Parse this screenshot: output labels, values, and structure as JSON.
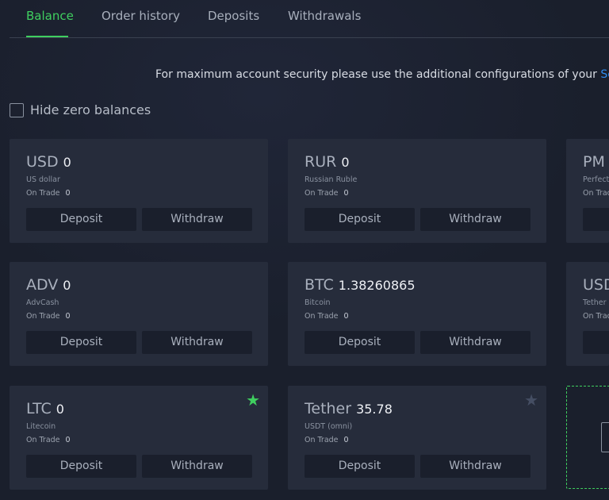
{
  "tabs": [
    {
      "label": "Balance",
      "active": true
    },
    {
      "label": "Order history",
      "active": false
    },
    {
      "label": "Deposits",
      "active": false
    },
    {
      "label": "Withdrawals",
      "active": false
    }
  ],
  "notice": {
    "text": "For maximum account security please use the additional configurations of your ",
    "link": "Sec"
  },
  "hide_zero": {
    "label": "Hide zero balances",
    "checked": false
  },
  "labels": {
    "on_trade": "On Trade",
    "deposit": "Deposit",
    "withdraw": "Withdraw"
  },
  "cards": [
    {
      "code": "USD",
      "amount": "0",
      "name": "US dollar",
      "on_trade": "0",
      "star": "none"
    },
    {
      "code": "RUR",
      "amount": "0",
      "name": "Russian Ruble",
      "on_trade": "0",
      "star": "none"
    },
    {
      "code": "PM",
      "amount": "",
      "name": "Perfect",
      "on_trade": "",
      "star": "none"
    },
    {
      "code": "ADV",
      "amount": "0",
      "name": "AdvCash",
      "on_trade": "0",
      "star": "none"
    },
    {
      "code": "BTC",
      "amount": "1.38260865",
      "name": "Bitcoin",
      "on_trade": "0",
      "star": "none"
    },
    {
      "code": "USD",
      "amount": "",
      "name": "Tether",
      "on_trade": "",
      "star": "none"
    },
    {
      "code": "LTC",
      "amount": "0",
      "name": "Litecoin",
      "on_trade": "0",
      "star": "filled"
    },
    {
      "code": "Tether",
      "amount": "35.78",
      "name": "USDT (omni)",
      "on_trade": "0",
      "star": "empty"
    }
  ],
  "colors": {
    "accent": "#3fcf5f",
    "link": "#2f8cf0",
    "card_bg": "#262c3b",
    "page_bg": "#1a1f2c"
  },
  "icons": {
    "star_filled": "star-filled-icon",
    "star_empty": "star-outline-icon"
  }
}
